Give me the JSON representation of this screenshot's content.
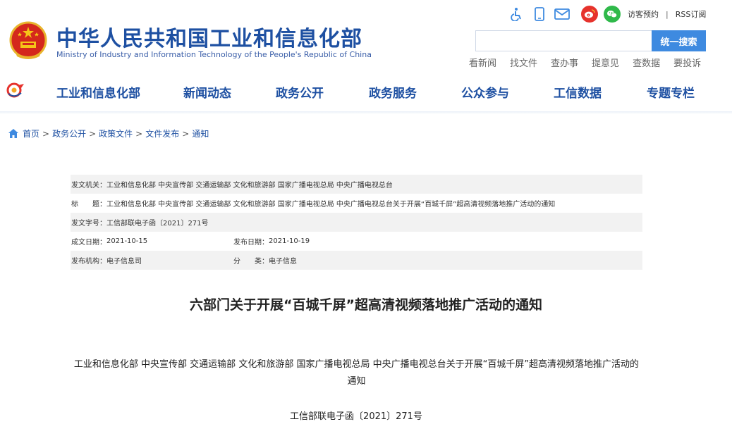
{
  "header": {
    "title_cn": "中华人民共和国工业和信息化部",
    "title_en": "Ministry of Industry and Information Technology of the People's Republic of China",
    "visitor_booking": "访客预约",
    "separator": "|",
    "rss": "RSS订阅",
    "icons": [
      "accessibility-icon",
      "mobile-icon",
      "email-icon",
      "weibo-icon",
      "wechat-icon"
    ]
  },
  "search": {
    "placeholder": "",
    "button_label": "统一搜索"
  },
  "quick_links": [
    "看新闻",
    "找文件",
    "查办事",
    "提意见",
    "查数据",
    "要投诉"
  ],
  "nav": {
    "items": [
      "工业和信息化部",
      "新闻动态",
      "政务公开",
      "政务服务",
      "公众参与",
      "工信数据",
      "专题专栏"
    ]
  },
  "breadcrumb": {
    "items": [
      "首页",
      "政务公开",
      "政策文件",
      "文件发布",
      "通知"
    ],
    "separator": ">"
  },
  "meta": {
    "issuer_label": "发文机关：",
    "issuer_value": "工业和信息化部 中央宣传部 交通运输部 文化和旅游部 国家广播电视总局 中央广播电视总台",
    "title_label": "标　　题：",
    "title_value": "工业和信息化部 中央宣传部 交通运输部 文化和旅游部 国家广播电视总局 中央广播电视总台关于开展“百城千屏”超高清视频落地推广活动的通知",
    "docno_label": "发文字号：",
    "docno_value": "工信部联电子函〔2021〕271号",
    "created_label": "成文日期：",
    "created_value": "2021-10-15",
    "published_label": "发布日期：",
    "published_value": "2021-10-19",
    "org_label": "发布机构：",
    "org_value": "电子信息司",
    "category_label": "分　　类：",
    "category_value": "电子信息"
  },
  "document": {
    "title": "六部门关于开展“百城千屏”超高清视频落地推广活动的通知",
    "paragraph": "工业和信息化部 中央宣传部 交通运输部 文化和旅游部 国家广播电视总局 中央广播电视总台关于开展“百城千屏”超高清视频落地推广活动的通知",
    "doc_number": "工信部联电子函〔2021〕271号"
  },
  "colors": {
    "brand_blue": "#1e50a2",
    "search_button": "#3e8ae0",
    "weibo_red": "#e6322c",
    "wechat_green": "#2fb94a",
    "meta_shade": "#f2f2f2"
  }
}
